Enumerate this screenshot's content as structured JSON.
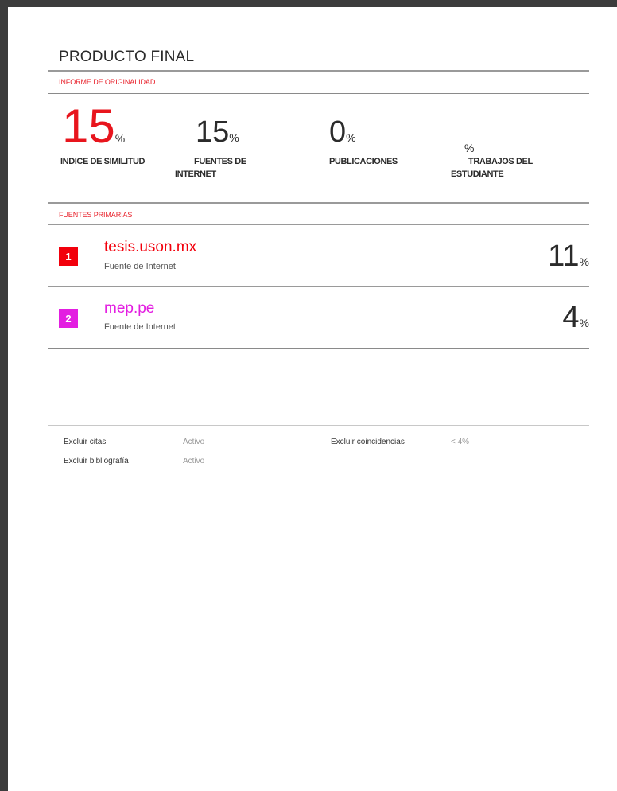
{
  "report_title": "PRODUCTO FINAL",
  "originality_label": "INFORME DE ORIGINALIDAD",
  "stats": {
    "similarity": {
      "value": "15",
      "unit": "%",
      "label": "INDICE DE SIMILITUD"
    },
    "internet": {
      "value": "15",
      "unit": "%",
      "label_line1": "FUENTES DE",
      "label_line2": "INTERNET"
    },
    "publications": {
      "value": "0",
      "unit": "%",
      "label": "PUBLICACIONES"
    },
    "student": {
      "value": "",
      "unit": "%",
      "label_line1": "TRABAJOS DEL",
      "label_line2": "ESTUDIANTE"
    }
  },
  "primary_sources_label": "FUENTES PRIMARIAS",
  "sources": [
    {
      "rank": "1",
      "name": "tesis.uson.mx",
      "type": "Fuente de Internet",
      "percent": "11",
      "unit": "%",
      "color": "#f2000c"
    },
    {
      "rank": "2",
      "name": "mep.pe",
      "type": "Fuente de Internet",
      "percent": "4",
      "unit": "%",
      "color": "#e31ee1"
    }
  ],
  "options": {
    "exclude_quotes": {
      "label": "Excluir citas",
      "value": "Activo"
    },
    "exclude_bibliography": {
      "label": "Excluir bibliografía",
      "value": "Activo"
    },
    "exclude_matches": {
      "label": "Excluir coincidencias",
      "value": "< 4%"
    }
  },
  "colors": {
    "accent": "#e8151d",
    "frame": "#3c3c3c"
  }
}
